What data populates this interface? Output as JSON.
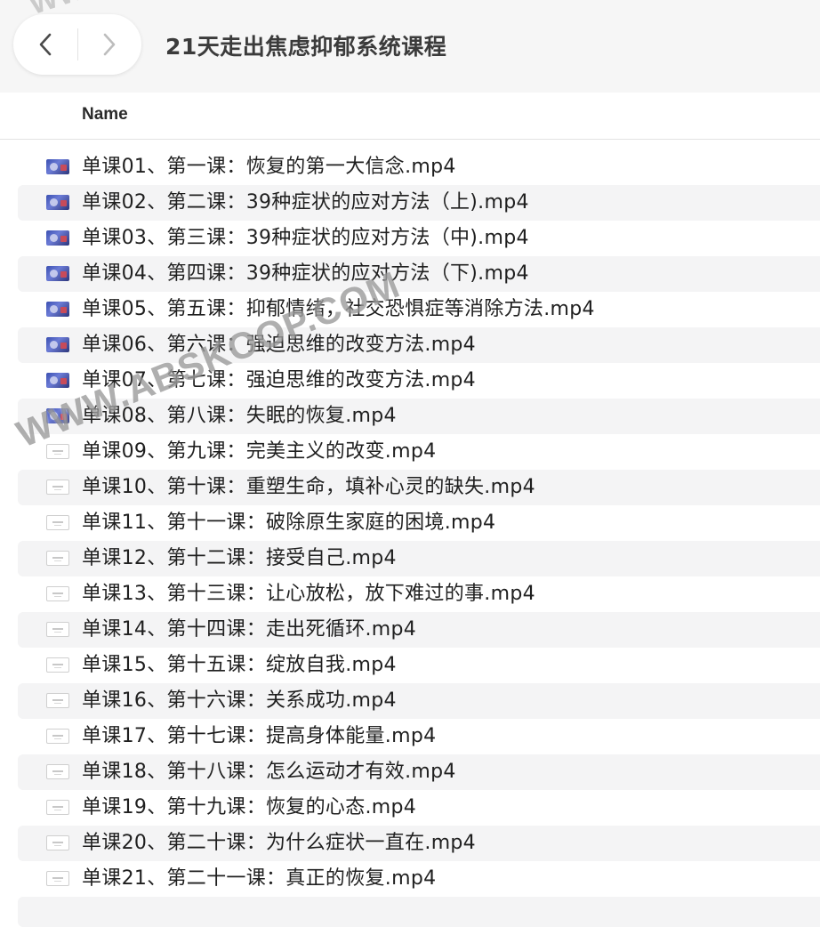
{
  "window": {
    "title": "21天走出焦虑抑郁系统课程"
  },
  "nav": {
    "back_icon": "chevron-left-icon",
    "forward_icon": "chevron-right-icon"
  },
  "columns": {
    "name": "Name"
  },
  "files": [
    {
      "name": "单课01、第一课：恢复的第一大信念.mp4",
      "icon": "video-thumbnail-icon"
    },
    {
      "name": "单课02、第二课：39种症状的应对方法（上).mp4",
      "icon": "video-thumbnail-icon"
    },
    {
      "name": "单课03、第三课：39种症状的应对方法（中).mp4",
      "icon": "video-thumbnail-icon"
    },
    {
      "name": "单课04、第四课：39种症状的应对方法（下).mp4",
      "icon": "video-thumbnail-icon"
    },
    {
      "name": "单课05、第五课：抑郁情绪，社交恐惧症等消除方法.mp4",
      "icon": "video-thumbnail-icon"
    },
    {
      "name": "单课06、第六课：强迫思维的改变方法.mp4",
      "icon": "video-thumbnail-icon"
    },
    {
      "name": "单课07、第七课：强迫思维的改变方法.mp4",
      "icon": "video-thumbnail-icon"
    },
    {
      "name": "单课08、第八课：失眠的恢复.mp4",
      "icon": "video-thumbnail-icon"
    },
    {
      "name": "单课09、第九课：完美主义的改变.mp4",
      "icon": "document-thumbnail-icon"
    },
    {
      "name": "单课10、第十课：重塑生命，填补心灵的缺失.mp4",
      "icon": "document-thumbnail-icon"
    },
    {
      "name": "单课11、第十一课：破除原生家庭的困境.mp4",
      "icon": "document-thumbnail-icon"
    },
    {
      "name": "单课12、第十二课：接受自己.mp4",
      "icon": "document-thumbnail-icon"
    },
    {
      "name": "单课13、第十三课：让心放松，放下难过的事.mp4",
      "icon": "document-thumbnail-icon"
    },
    {
      "name": "单课14、第十四课：走出死循环.mp4",
      "icon": "document-thumbnail-icon"
    },
    {
      "name": "单课15、第十五课：绽放自我.mp4",
      "icon": "document-thumbnail-icon"
    },
    {
      "name": "单课16、第十六课：关系成功.mp4",
      "icon": "document-thumbnail-icon"
    },
    {
      "name": "单课17、第十七课：提高身体能量.mp4",
      "icon": "document-thumbnail-icon"
    },
    {
      "name": "单课18、第十八课：怎么运动才有效.mp4",
      "icon": "document-thumbnail-icon"
    },
    {
      "name": "单课19、第十九课：恢复的心态.mp4",
      "icon": "document-thumbnail-icon"
    },
    {
      "name": "单课20、第二十课：为什么症状一直在.mp4",
      "icon": "document-thumbnail-icon"
    },
    {
      "name": "单课21、第二十一课：真正的恢复.mp4",
      "icon": "document-thumbnail-icon"
    }
  ],
  "watermarks": {
    "top": "WW",
    "main": "WWW.ABSKOOP.COM"
  },
  "colors": {
    "toolbar_bg": "#f6f6f6",
    "row_alt_bg": "#f4f4f5",
    "title_text": "#3b3b3b"
  }
}
